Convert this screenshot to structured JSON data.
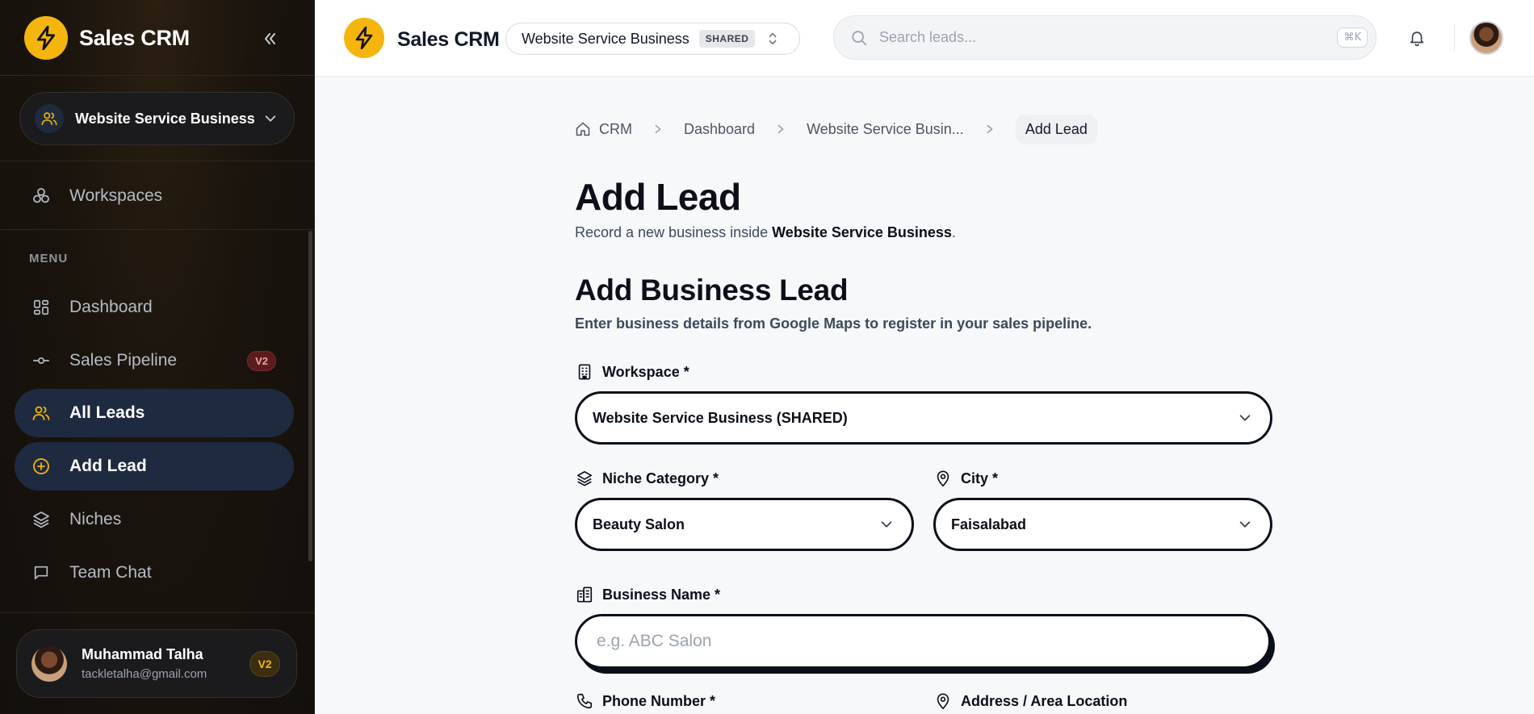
{
  "app": {
    "name": "Sales CRM"
  },
  "sidebar": {
    "workspace_switch": "Website Service Business",
    "workspaces_label": "Workspaces",
    "menu_label": "MENU",
    "items": [
      {
        "label": "Dashboard"
      },
      {
        "label": "Sales Pipeline",
        "badge": "V2"
      },
      {
        "label": "All Leads"
      },
      {
        "label": "Add Lead"
      },
      {
        "label": "Niches"
      },
      {
        "label": "Team Chat"
      }
    ],
    "user": {
      "name": "Muhammad Talha",
      "email": "tackletalha@gmail.com",
      "badge": "V2"
    }
  },
  "topbar": {
    "workspace": "Website Service Business",
    "workspace_tag": "SHARED",
    "search_placeholder": "Search leads...",
    "shortcut": "⌘K"
  },
  "breadcrumb": [
    "CRM",
    "Dashboard",
    "Website Service Busin...",
    "Add Lead"
  ],
  "page": {
    "title": "Add Lead",
    "subtitle_prefix": "Record a new business inside ",
    "subtitle_strong": "Website Service Business",
    "subtitle_suffix": "."
  },
  "form": {
    "title": "Add Business Lead",
    "subtitle": "Enter business details from Google Maps to register in your sales pipeline.",
    "workspace_label": "Workspace *",
    "workspace_value": "Website Service Business (SHARED)",
    "niche_label": "Niche Category *",
    "niche_value": "Beauty Salon",
    "city_label": "City *",
    "city_value": "Faisalabad",
    "business_name_label": "Business Name *",
    "business_name_placeholder": "e.g. ABC Salon",
    "phone_label": "Phone Number *",
    "address_label": "Address / Area Location"
  },
  "colors": {
    "accent": "#f5b50c",
    "sidebar_bg": "#130f0b",
    "active_nav": "#1e2a3f",
    "ink": "#0b0f19"
  }
}
